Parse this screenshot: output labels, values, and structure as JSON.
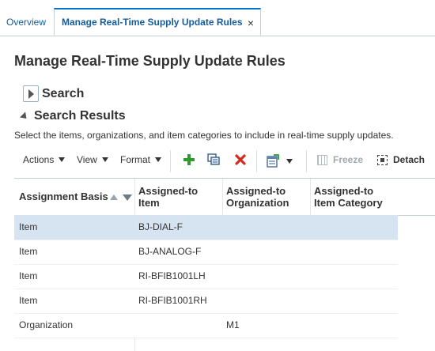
{
  "tabs": {
    "overview": "Overview",
    "active": "Manage Real-Time Supply Update Rules",
    "close": "×"
  },
  "page": {
    "title": "Manage Real-Time Supply Update Rules"
  },
  "search": {
    "label": "Search"
  },
  "results": {
    "label": "Search Results",
    "instructions": "Select the items, organizations, and item categories to include in real-time supply updates."
  },
  "toolbar": {
    "actions": "Actions",
    "view": "View",
    "format": "Format",
    "freeze": "Freeze",
    "detach": "Detach",
    "icons": [
      "add-icon",
      "edit-icon",
      "delete-icon",
      "export-icon"
    ]
  },
  "table": {
    "columns": [
      [
        "Assignment Basis"
      ],
      [
        "Assigned-to",
        "Item"
      ],
      [
        "Assigned-to",
        "Organization"
      ],
      [
        "Assigned-to",
        "Item Category"
      ]
    ],
    "rows": [
      {
        "basis": "Item",
        "item": "BJ-DIAL-F",
        "org": "",
        "category": "",
        "selected": true
      },
      {
        "basis": "Item",
        "item": "BJ-ANALOG-F",
        "org": "",
        "category": ""
      },
      {
        "basis": "Item",
        "item": "RI-BFIB1001LH",
        "org": "",
        "category": ""
      },
      {
        "basis": "Item",
        "item": "RI-BFIB1001RH",
        "org": "",
        "category": ""
      },
      {
        "basis": "Organization",
        "item": "",
        "org": "M1",
        "category": ""
      }
    ]
  },
  "colors": {
    "link": "#145c9e",
    "selected_row": "#d6e4f2",
    "add": "#2f9a2f",
    "delete": "#d42b1e"
  }
}
